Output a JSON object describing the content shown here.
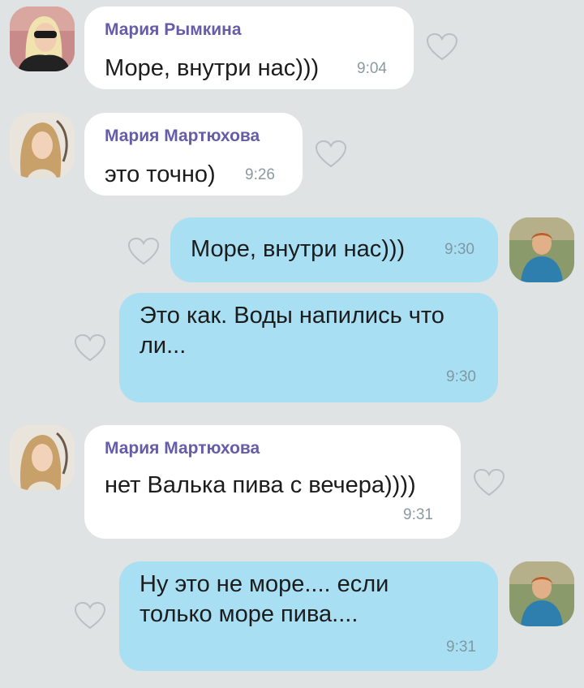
{
  "theme": {
    "background": "#dfe3e3",
    "incoming_bubble": "#ffffff",
    "outgoing_bubble": "#a8dff3",
    "sender_color": "#665ca8",
    "time_color": "#8a9aa0"
  },
  "messages": [
    {
      "direction": "incoming",
      "sender": "Мария Рымкина",
      "text": "Море, внутри нас)))",
      "time": "9:04",
      "avatar": "avatar-blonde-woman-sunglasses"
    },
    {
      "direction": "incoming",
      "sender": "Мария Мартюхова",
      "text": "это точно)",
      "time": "9:26",
      "avatar": "avatar-woman-long-hair"
    },
    {
      "direction": "outgoing",
      "text": "Море, внутри нас)))",
      "time": "9:30",
      "avatar": "avatar-woman-in-blue"
    },
    {
      "direction": "outgoing",
      "text": "Это как. Воды напились что ли...",
      "time": "9:30"
    },
    {
      "direction": "incoming",
      "sender": "Мария Мартюхова",
      "text": "нет Валька пива с вечера))))",
      "time": "9:31",
      "avatar": "avatar-woman-long-hair"
    },
    {
      "direction": "outgoing",
      "text": "Ну это не море.... если только море пива....",
      "time": "9:31",
      "avatar": "avatar-woman-in-blue"
    }
  ],
  "icons": {
    "like": "heart-outline-icon"
  }
}
